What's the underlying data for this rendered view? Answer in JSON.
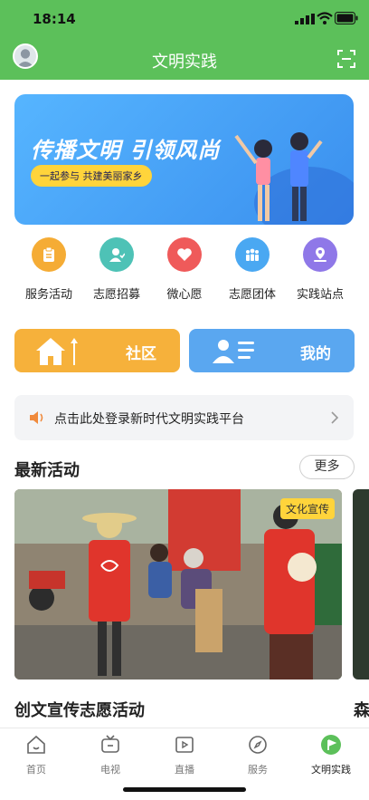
{
  "status": {
    "time": "18:14"
  },
  "header": {
    "title": "文明实践"
  },
  "banner": {
    "title": "传播文明 引领风尚",
    "subtitle": "一起参与 共建美丽家乡"
  },
  "quick": [
    {
      "label": "服务活动",
      "icon": "clipboard-icon",
      "color": "#f5ac35"
    },
    {
      "label": "志愿招募",
      "icon": "volunteer-icon",
      "color": "#4ec2b6"
    },
    {
      "label": "微心愿",
      "icon": "heart-icon",
      "color": "#ef5a5a"
    },
    {
      "label": "志愿团体",
      "icon": "group-icon",
      "color": "#4aa8f2"
    },
    {
      "label": "实践站点",
      "icon": "location-icon",
      "color": "#8f78e8"
    }
  ],
  "cards": {
    "left_label": "社区",
    "right_label": "我的"
  },
  "notice": {
    "text": "点击此处登录新时代文明实践平台"
  },
  "section": {
    "title": "最新活动",
    "more": "更多"
  },
  "activity": {
    "tag": "文化宣传",
    "title": "创文宣传志愿活动",
    "peek_title": "森"
  },
  "tabs": [
    {
      "label": "首页",
      "icon": "home-icon"
    },
    {
      "label": "电视",
      "icon": "tv-icon"
    },
    {
      "label": "直播",
      "icon": "play-icon"
    },
    {
      "label": "服务",
      "icon": "compass-icon"
    },
    {
      "label": "文明实践",
      "icon": "flag-icon",
      "active": true
    }
  ],
  "colors": {
    "header_green": "#5cc05a",
    "banner_blue": "#3a8fee",
    "card_orange": "#f6b13b",
    "card_blue": "#5aa7f0",
    "active_tab_green": "#5cc05a"
  }
}
